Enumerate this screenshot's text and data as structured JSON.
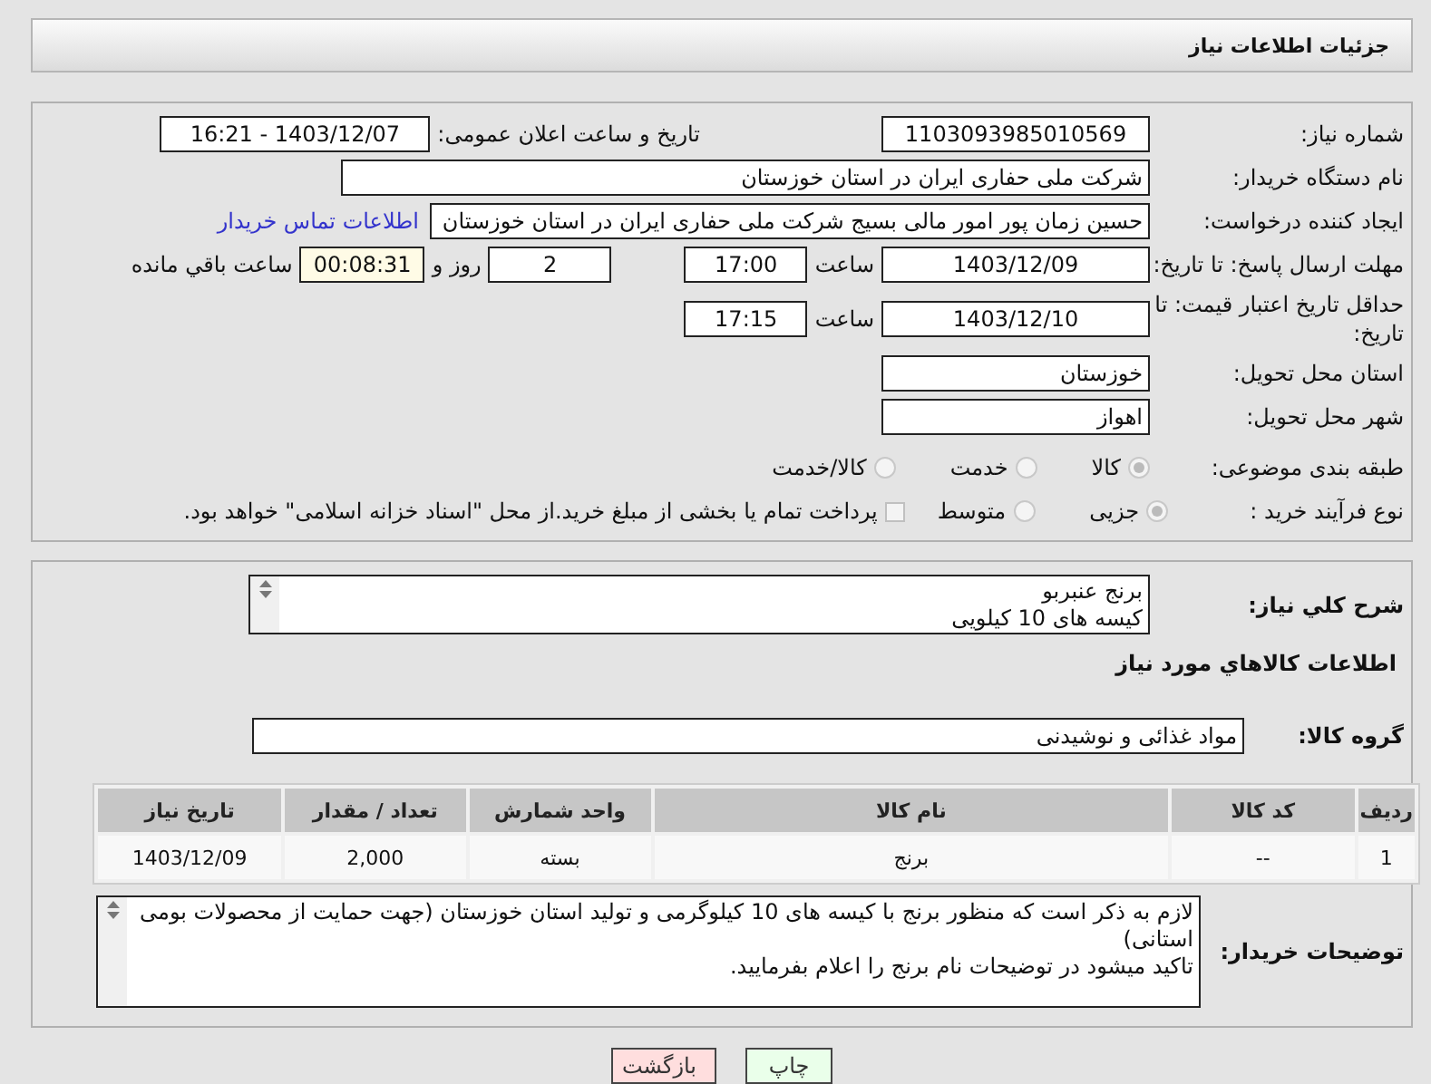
{
  "header": {
    "title": "جزئیات اطلاعات نیاز"
  },
  "details": {
    "need_number": {
      "label": "شماره نیاز:",
      "value": "1103093985010569"
    },
    "announce": {
      "label": "تاریخ و ساعت اعلان عمومی:",
      "value": "1403/12/07 - 16:21"
    },
    "buyer": {
      "label": "نام دستگاه خریدار:",
      "value": "شرکت ملی حفاری ایران در استان خوزستان"
    },
    "requester": {
      "label": "ایجاد کننده درخواست:",
      "value": "حسین زمان پور امور مالی بسیج شرکت ملی حفاری ایران در استان خوزستان",
      "link": "اطلاعات تماس خریدار"
    },
    "reply_deadline": {
      "label": "مهلت ارسال پاسخ: تا تاریخ:",
      "date": "1403/12/09",
      "time_label": "ساعت",
      "time": "17:00",
      "days": "2",
      "days_label": "روز و",
      "remaining": "00:08:31",
      "remaining_label": "ساعت باقي مانده"
    },
    "price_validity": {
      "label": "حداقل تاریخ اعتبار قیمت: تا تاریخ:",
      "date": "1403/12/10",
      "time_label": "ساعت",
      "time": "17:15"
    },
    "province": {
      "label": "استان محل تحویل:",
      "value": "خوزستان"
    },
    "city": {
      "label": "شهر محل تحویل:",
      "value": "اهواز"
    },
    "category": {
      "label": "طبقه بندی موضوعی:",
      "options": [
        {
          "label": "کالا",
          "selected": true
        },
        {
          "label": "خدمت",
          "selected": false
        },
        {
          "label": "کالا/خدمت",
          "selected": false
        }
      ]
    },
    "process": {
      "label": "نوع فرآیند خرید :",
      "options": [
        {
          "label": "جزیی",
          "selected": true
        },
        {
          "label": "متوسط",
          "selected": false
        }
      ],
      "treasury": {
        "label": "پرداخت تمام یا بخشی از مبلغ خرید.از محل \"اسناد خزانه اسلامی\" خواهد بود.",
        "checked": false
      }
    }
  },
  "summary": {
    "label": "شرح کلي نیاز:",
    "lines": [
      "برنج عنبربو",
      "کیسه های 10 کیلویی"
    ]
  },
  "goods": {
    "heading": "اطلاعات کالاهاي مورد نیاز",
    "group_label": "گروه کالا:",
    "group": "مواد غذائی و نوشیدنی",
    "table": {
      "columns": [
        "ردیف",
        "کد کالا",
        "نام کالا",
        "واحد شمارش",
        "تعداد / مقدار",
        "تاریخ نیاز"
      ],
      "rows": [
        [
          "1",
          "--",
          "برنج",
          "بسته",
          "2,000",
          "1403/12/09"
        ]
      ]
    }
  },
  "buyer_notes": {
    "label": "توضیحات خریدار:",
    "lines": [
      "لازم به ذکر است که منظور برنج با کیسه های 10 کیلوگرمی و تولید استان خوزستان (جهت حمایت از محصولات بومی استانی)",
      "تاکید میشود در توضیحات نام برنج را اعلام بفرمایید."
    ]
  },
  "buttons": [
    {
      "label": "چاپ",
      "kind": "print"
    },
    {
      "label": "بازگشت",
      "kind": "back"
    }
  ]
}
